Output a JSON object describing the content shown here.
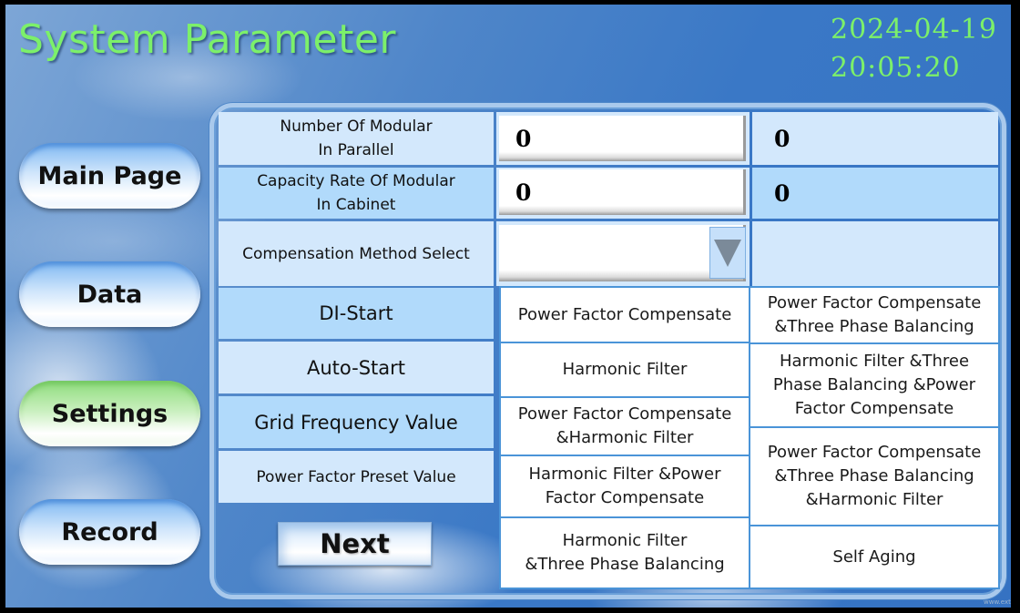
{
  "header": {
    "title": "System Parameter",
    "date": "2024-04-19",
    "time": "20:05:20"
  },
  "nav": {
    "items": [
      {
        "label": "Main Page",
        "active": false
      },
      {
        "label": "Data",
        "active": false
      },
      {
        "label": "Settings",
        "active": true
      },
      {
        "label": "Record",
        "active": false
      }
    ]
  },
  "params": {
    "modular_parallel": {
      "label_line1": "Number Of Modular",
      "label_line2": "In Parallel",
      "input_value": "0",
      "current_value": "0"
    },
    "capacity_rate": {
      "label_line1": "Capacity Rate Of Modular",
      "label_line2": "In Cabinet",
      "input_value": "0",
      "current_value": "0"
    },
    "compensation_method": {
      "label": "Compensation Method Select",
      "selected": ""
    },
    "di_start": {
      "label": "DI-Start"
    },
    "auto_start": {
      "label": "Auto-Start"
    },
    "grid_frequency": {
      "label": "Grid Frequency Value"
    },
    "power_factor_preset": {
      "label": "Power Factor Preset Value"
    }
  },
  "compensation_options": {
    "left": [
      {
        "line1": "Power Factor Compensate",
        "line2": ""
      },
      {
        "line1": "Harmonic Filter",
        "line2": ""
      },
      {
        "line1": "Power Factor Compensate",
        "line2": "&Harmonic Filter"
      },
      {
        "line1": "Harmonic Filter &Power",
        "line2": "Factor Compensate"
      },
      {
        "line1": "Harmonic Filter",
        "line2": "&Three Phase Balancing"
      }
    ],
    "right": [
      {
        "line1": "Power Factor Compensate",
        "line2": "&Three Phase Balancing",
        "line3": ""
      },
      {
        "line1": "Harmonic Filter  &Three",
        "line2": "Phase Balancing  &Power",
        "line3": "Factor Compensate"
      },
      {
        "line1": "Power Factor Compensate",
        "line2": "&Three Phase Balancing",
        "line3": "&Harmonic Filter"
      },
      {
        "line1": "Self Aging",
        "line2": "",
        "line3": ""
      }
    ]
  },
  "footer": {
    "next_label": "Next",
    "watermark": "www.ext"
  },
  "colors": {
    "title_green": "#7cf06a",
    "row_light": "#d3e8fc",
    "row_dark": "#b1dafb",
    "active_nav_green": "#8edc7c",
    "option_border": "#4a94d8"
  }
}
